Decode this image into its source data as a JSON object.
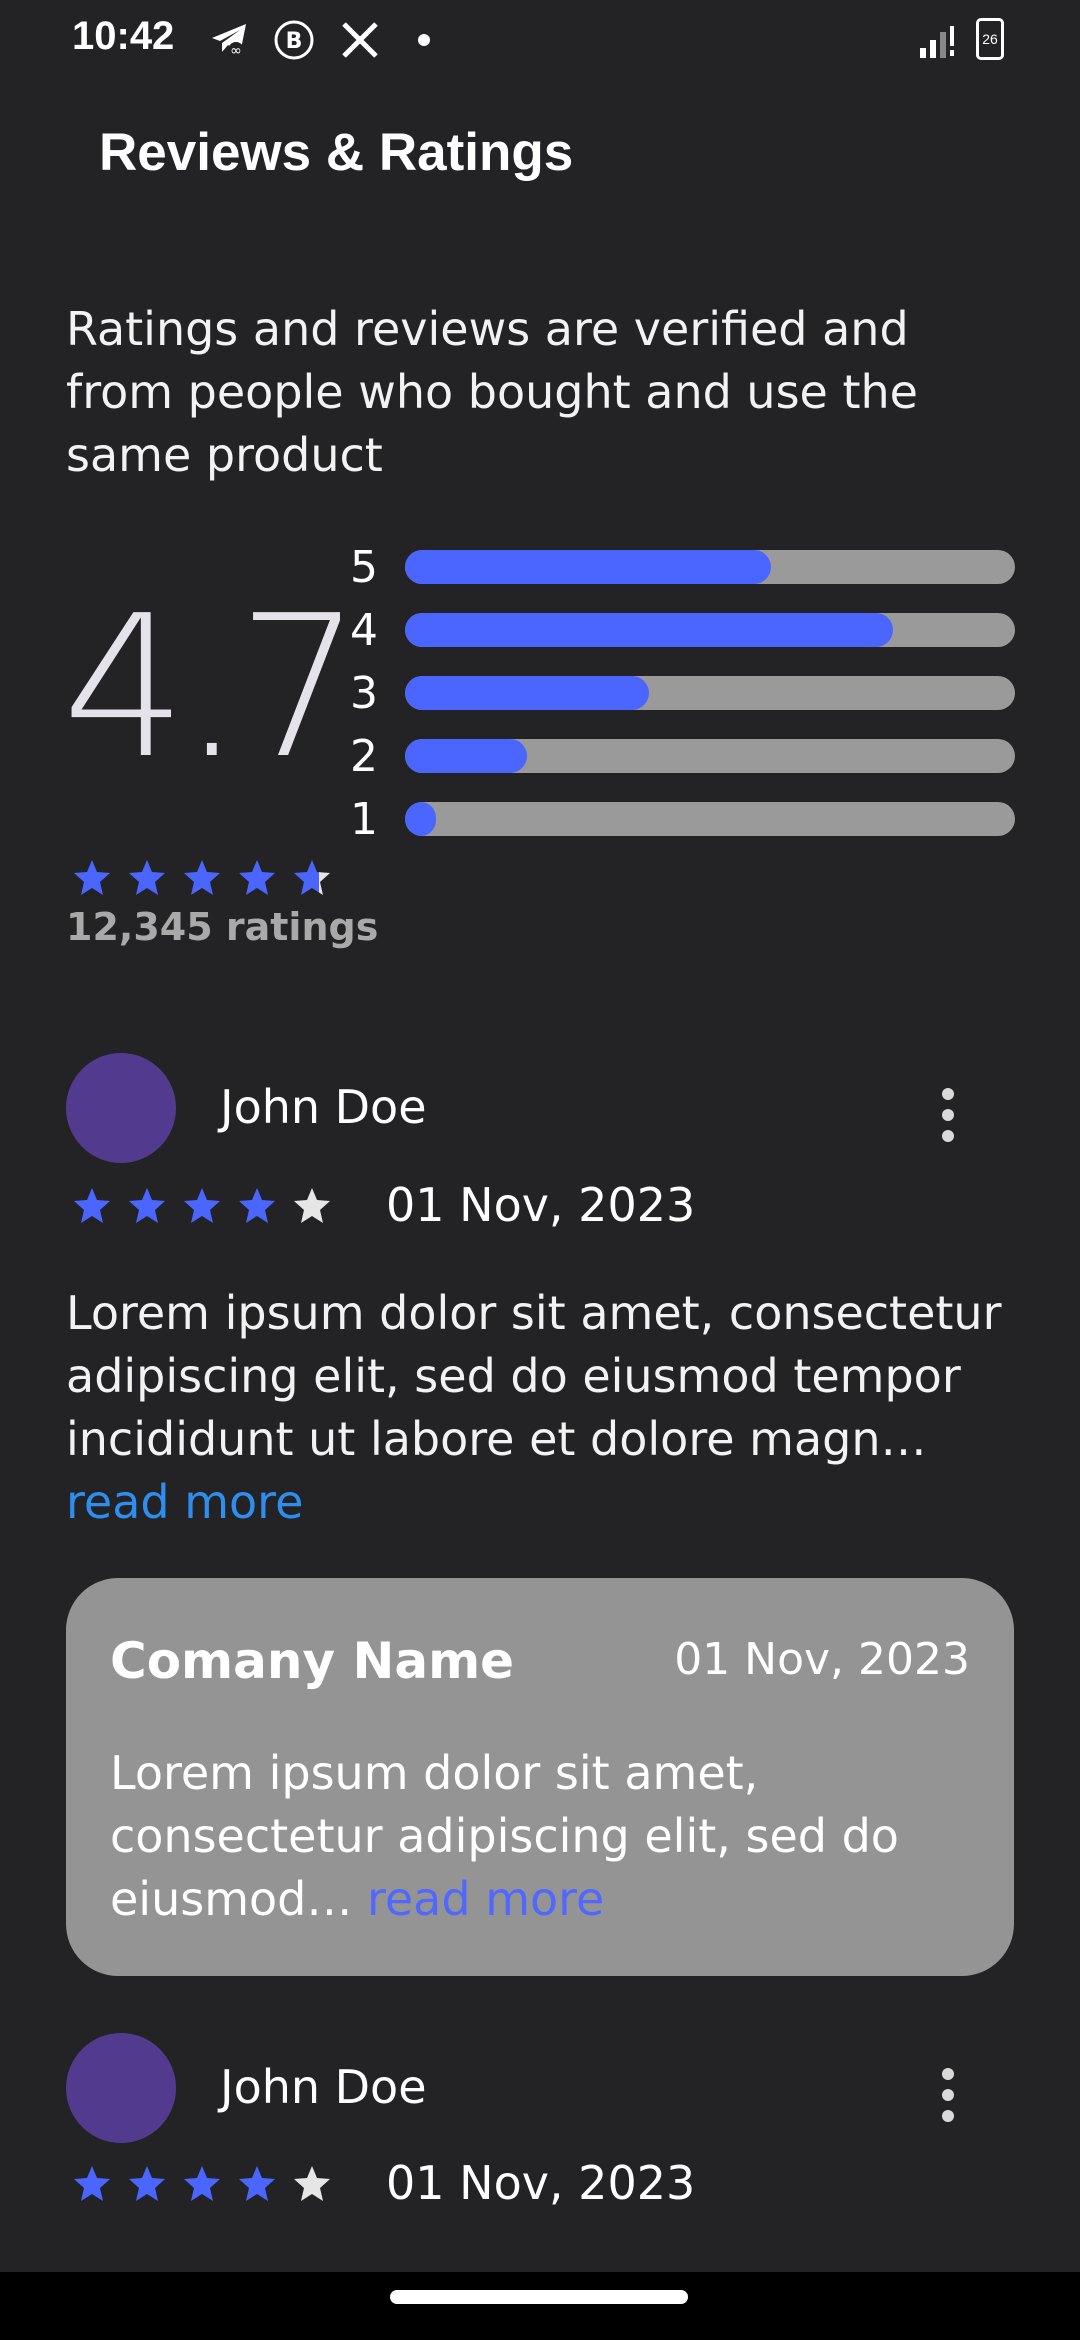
{
  "status_bar": {
    "time": "10:42",
    "icons": [
      "telegram-icon",
      "b-icon",
      "x-icon",
      "dot-icon",
      "signal-icon",
      "battery-icon"
    ],
    "battery": "26"
  },
  "header": {
    "title": "Reviews & Ratings"
  },
  "intro": "Ratings and reviews are verified and from people who bought and use the same product",
  "summary": {
    "average": "4.7",
    "stars_value": 4.7,
    "ratings_count": "12,345 ratings",
    "bars": [
      {
        "label": "5",
        "fraction": 0.6
      },
      {
        "label": "4",
        "fraction": 0.8
      },
      {
        "label": "3",
        "fraction": 0.4
      },
      {
        "label": "2",
        "fraction": 0.2
      },
      {
        "label": "1",
        "fraction": 0.05
      }
    ]
  },
  "reviews": [
    {
      "name": "John Doe",
      "rating": 4,
      "date": "01 Nov, 2023",
      "text": "Lorem ipsum dolor sit amet, consectetur adipiscing elit, sed do eiusmod tempor incididunt ut labore et dolore magn…",
      "read_more": "read more",
      "reply": {
        "company": "Comany Name",
        "date": "01 Nov, 2023",
        "text": "Lorem ipsum dolor sit amet, consectetur adipiscing elit, sed do eiusmod… ",
        "read_more": "read more"
      }
    },
    {
      "name": "John Doe",
      "rating": 4,
      "date": "01 Nov, 2023"
    }
  ],
  "colors": {
    "accent": "#4a66ff",
    "link": "#2d8ef0",
    "background": "#232325",
    "avatar": "#523b8e"
  }
}
